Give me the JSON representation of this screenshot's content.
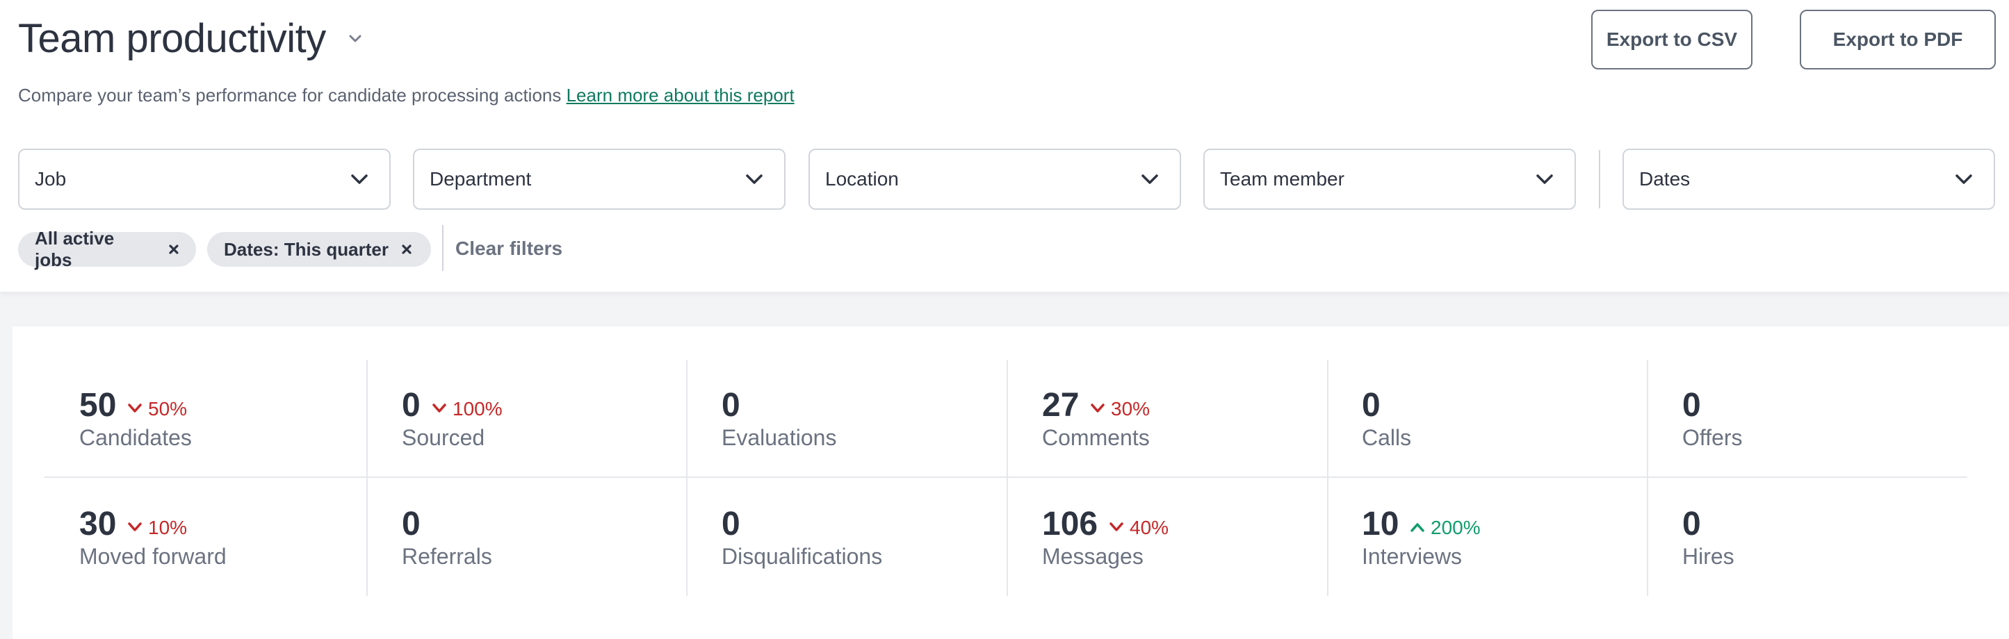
{
  "header": {
    "title": "Team productivity",
    "subtitle": "Compare your team’s performance for candidate processing actions",
    "learn_more": "Learn more about this report",
    "export_csv": "Export to CSV",
    "export_pdf": "Export to PDF"
  },
  "filters": {
    "job": "Job",
    "department": "Department",
    "location": "Location",
    "team_member": "Team member",
    "dates": "Dates"
  },
  "chips": {
    "all_active_jobs": "All active jobs",
    "dates_quarter": "Dates: This quarter",
    "clear": "Clear filters"
  },
  "metrics": {
    "row1": [
      {
        "value": "50",
        "label": "Candidates",
        "delta": "50%",
        "trend": "down"
      },
      {
        "value": "0",
        "label": "Sourced",
        "delta": "100%",
        "trend": "down"
      },
      {
        "value": "0",
        "label": "Evaluations",
        "delta": "",
        "trend": "none"
      },
      {
        "value": "27",
        "label": "Comments",
        "delta": "30%",
        "trend": "down"
      },
      {
        "value": "0",
        "label": "Calls",
        "delta": "",
        "trend": "none"
      },
      {
        "value": "0",
        "label": "Offers",
        "delta": "",
        "trend": "none"
      }
    ],
    "row2": [
      {
        "value": "30",
        "label": "Moved forward",
        "delta": "10%",
        "trend": "down"
      },
      {
        "value": "0",
        "label": "Referrals",
        "delta": "",
        "trend": "none"
      },
      {
        "value": "0",
        "label": "Disqualifications",
        "delta": "",
        "trend": "none"
      },
      {
        "value": "106",
        "label": "Messages",
        "delta": "40%",
        "trend": "down"
      },
      {
        "value": "10",
        "label": "Interviews",
        "delta": "200%",
        "trend": "up"
      },
      {
        "value": "0",
        "label": "Hires",
        "delta": "",
        "trend": "none"
      }
    ]
  },
  "colors": {
    "down": "#c62828",
    "up": "#0f9d6b",
    "link": "#0e7a5f"
  },
  "icons": {
    "caret": "chevron-down-icon",
    "remove": "close-icon",
    "trend_down": "chevron-down-icon",
    "trend_up": "chevron-up-icon"
  }
}
